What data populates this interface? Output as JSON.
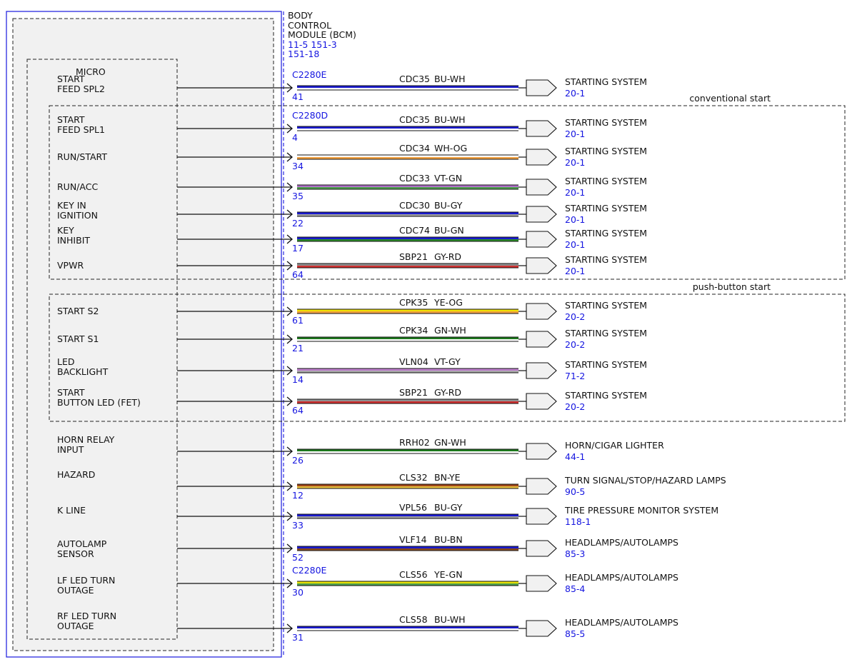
{
  "module": {
    "title_lines": [
      "BODY",
      "CONTROL",
      "MODULE (BCM)"
    ],
    "ref_lines": [
      "11-5  151-3",
      "151-18"
    ],
    "micro_label": "MICRO",
    "border_color": "#2a2ae0",
    "ref_color": "#1515e0"
  },
  "groups": [
    {
      "label": "conventional start"
    },
    {
      "label": "push-button start"
    }
  ],
  "circuits": [
    {
      "signal": [
        "START",
        "FEED SPL2"
      ],
      "connector": "C2280E",
      "pin": "41",
      "circuit": "CDC35",
      "color": "BU-WH",
      "wire": [
        "#1a1ad0",
        "#ffffff"
      ],
      "dest": "STARTING SYSTEM",
      "ref": "20-1"
    },
    {
      "signal": [
        "START",
        "FEED SPL1"
      ],
      "connector": "C2280D",
      "pin": "4",
      "circuit": "CDC35",
      "color": "BU-WH",
      "wire": [
        "#1a1ad0",
        "#ffffff"
      ],
      "dest": "STARTING SYSTEM",
      "ref": "20-1"
    },
    {
      "signal": [
        "RUN/START"
      ],
      "connector": "",
      "pin": "34",
      "circuit": "CDC34",
      "color": "WH-OG",
      "wire": [
        "#ffffff",
        "#f0a040"
      ],
      "dest": "STARTING SYSTEM",
      "ref": "20-1"
    },
    {
      "signal": [
        "RUN/ACC"
      ],
      "connector": "",
      "pin": "35",
      "circuit": "CDC33",
      "color": "VT-GN",
      "wire": [
        "#b070c8",
        "#50a050"
      ],
      "dest": "STARTING SYSTEM",
      "ref": "20-1"
    },
    {
      "signal": [
        "KEY IN",
        "IGNITION"
      ],
      "connector": "",
      "pin": "22",
      "circuit": "CDC30",
      "color": "BU-GY",
      "wire": [
        "#1a1ad0",
        "#a0a0a0"
      ],
      "dest": "STARTING SYSTEM",
      "ref": "20-1"
    },
    {
      "signal": [
        "KEY",
        "INHIBIT"
      ],
      "connector": "",
      "pin": "17",
      "circuit": "CDC74",
      "color": "BU-GN",
      "wire": [
        "#1a1ad0",
        "#2a8a2a"
      ],
      "dest": "STARTING SYSTEM",
      "ref": " 20-1"
    },
    {
      "signal": [
        "VPWR"
      ],
      "connector": "",
      "pin": "64",
      "circuit": "SBP21",
      "color": "GY-RD",
      "wire": [
        "#909090",
        "#d03030"
      ],
      "dest": "STARTING SYSTEM",
      "ref": "20-1"
    },
    {
      "signal": [
        "START S2"
      ],
      "connector": "",
      "pin": "61",
      "circuit": "CPK35",
      "color": "YE-OG",
      "wire": [
        "#f0e000",
        "#f0a040"
      ],
      "dest": "STARTING SYSTEM",
      "ref": "20-2"
    },
    {
      "signal": [
        "START S1"
      ],
      "connector": "",
      "pin": "21",
      "circuit": "CPK34",
      "color": "GN-WH",
      "wire": [
        "#1e7a1e",
        "#ffffff"
      ],
      "dest": "STARTING SYSTEM",
      "ref": "20-2"
    },
    {
      "signal": [
        "LED",
        "BACKLIGHT"
      ],
      "connector": "",
      "pin": "14",
      "circuit": "VLN04",
      "color": "VT-GY",
      "wire": [
        "#c080d0",
        "#a8a8a8"
      ],
      "dest": "STARTING SYSTEM",
      "ref": "71-2"
    },
    {
      "signal": [
        "START",
        "BUTTON LED (FET)"
      ],
      "connector": "",
      "pin": "64",
      "circuit": "SBP21",
      "color": "GY-RD",
      "wire": [
        "#909090",
        "#d03030"
      ],
      "dest": "STARTING SYSTEM",
      "ref": "20-2"
    },
    {
      "signal": [
        "HORN RELAY",
        "INPUT"
      ],
      "connector": "",
      "pin": "26",
      "circuit": "RRH02",
      "color": "GN-WH",
      "wire": [
        "#1e7a1e",
        "#ffffff"
      ],
      "dest": "HORN/CIGAR LIGHTER",
      "ref": "44-1"
    },
    {
      "signal": [
        "HAZARD"
      ],
      "connector": "",
      "pin": "12",
      "circuit": "CLS32",
      "color": "BN-YE",
      "wire": [
        "#a0481a",
        "#e8c040"
      ],
      "dest": "TURN SIGNAL/STOP/HAZARD LAMPS",
      "ref": "90-5"
    },
    {
      "signal": [
        "K LINE"
      ],
      "connector": "",
      "pin": "33",
      "circuit": "VPL56",
      "color": "BU-GY",
      "wire": [
        "#1a1ad0",
        "#a0a0a0"
      ],
      "dest": "TIRE PRESSURE MONITOR SYSTEM",
      "ref": "118-1"
    },
    {
      "signal": [
        "AUTOLAMP",
        "SENSOR"
      ],
      "connector": "",
      "pin": "52",
      "circuit": "VLF14",
      "color": "BU-BN",
      "wire": [
        "#1a1ad0",
        "#8a4a1a"
      ],
      "dest": "HEADLAMPS/AUTOLAMPS",
      "ref": "85-3"
    },
    {
      "signal": [
        "LF LED TURN",
        "OUTAGE"
      ],
      "connector": "C2280E",
      "pin": "30",
      "circuit": "CLS56",
      "color": "YE-GN",
      "wire": [
        "#e8e000",
        "#50a050"
      ],
      "dest": "HEADLAMPS/AUTOLAMPS",
      "ref": "85-4"
    },
    {
      "signal": [
        "RF LED TURN",
        "OUTAGE"
      ],
      "connector": "",
      "pin": "31",
      "circuit": "CLS58",
      "color": "BU-WH",
      "wire": [
        "#1a1ad0",
        "#ffffff"
      ],
      "dest": "HEADLAMPS/AUTOLAMPS",
      "ref": "85-5"
    }
  ]
}
